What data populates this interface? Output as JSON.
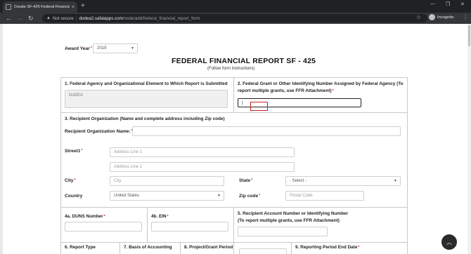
{
  "browser": {
    "tab_title": "Create SF-425 Federal Financial R...",
    "tab_close": "×",
    "new_tab": "+",
    "win_min": "—",
    "win_restore": "❐",
    "win_close": "✕",
    "back": "←",
    "forward": "→",
    "reload": "↻",
    "security_label": "Not secure",
    "separator": "|",
    "url_host": "dodea2.safalapps.com",
    "url_path": "/node/add/federal_financial_report_form",
    "star": "☆",
    "incognito_label": "Incognito",
    "menu": "⋮"
  },
  "form": {
    "award_year_label": "Award Year",
    "award_year_value": "2019",
    "title": "FEDERAL FINANCIAL REPORT SF - 425",
    "subtitle": "(Follow form Instructions)",
    "section1_label": "1. Federal Agency and Organizational Element to Which Report is Submitted",
    "section1_value": "DoDEA",
    "section2_label_line1": "2. Federal Grant or Other Identifying Number Assigned by Federal Agency (To",
    "section2_label_line2": "report multiple grants, use FFR Attachment)",
    "section2_value": "|",
    "section3_label": "3. Recipient Organization (Name and complete address including Zip code)",
    "recipient_org_label": "Recipient Organization Name:",
    "street_label": "Street1",
    "address1_placeholder": "Address Line 1",
    "address2_placeholder": "Address Line 2",
    "city_label": "City",
    "city_placeholder": "City",
    "state_label": "State",
    "state_value": "- Select -",
    "country_label": "Country",
    "country_value": "United States",
    "zip_label": "Zip code",
    "zip_placeholder": "Postal Code",
    "duns_label": "4a. DUNS Number",
    "ein_label": "4b. EIN",
    "section5_label_line1": "5. Recipient Account Number or Identifying Number",
    "section5_label_line2": "(To report multiple grants, use FFR Attachment)",
    "section6_label": "6. Report Type",
    "section7_label": "7. Basis of Accounting",
    "section8_label": "8. Project/Grant Period",
    "section9_label": "9. Reporting Period End Date",
    "required_mark": "*",
    "scroll_top_icon": "︿"
  }
}
